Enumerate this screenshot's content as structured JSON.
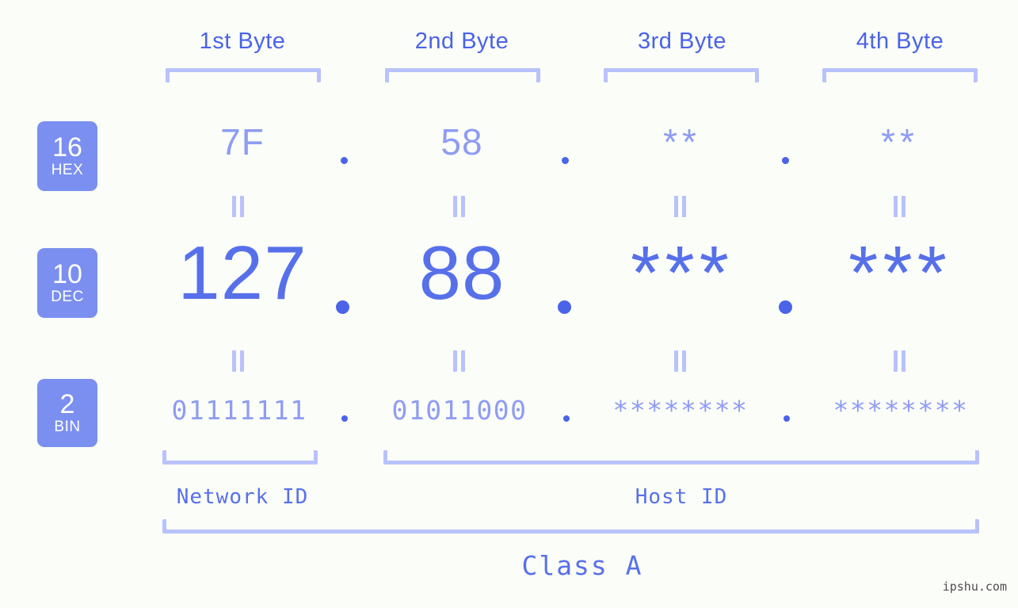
{
  "background_color": "#fbfdf9",
  "colors": {
    "accent": "#5770ea",
    "accent_light": "#8e9cf2",
    "bracket": "#b8c2fb",
    "badge_bg": "#7b8ff0",
    "badge_text": "#ffffff",
    "dot": "#4a63e7",
    "watermark": "#4d4d4d"
  },
  "byte_headers": [
    {
      "label": "1st Byte"
    },
    {
      "label": "2nd Byte"
    },
    {
      "label": "3rd Byte"
    },
    {
      "label": "4th Byte"
    }
  ],
  "rows": [
    {
      "base": "16",
      "system": "HEX",
      "values": [
        "7F",
        "58",
        "**",
        "**"
      ]
    },
    {
      "base": "10",
      "system": "DEC",
      "values": [
        "127",
        "88",
        "***",
        "***"
      ]
    },
    {
      "base": "2",
      "system": "BIN",
      "values": [
        "01111111",
        "01011000",
        "********",
        "********"
      ]
    }
  ],
  "separators": {
    "dot": ".",
    "equals": "="
  },
  "ranges": {
    "network_id": "Network ID",
    "host_id": "Host ID",
    "class": "Class A"
  },
  "watermark": "ipshu.com"
}
